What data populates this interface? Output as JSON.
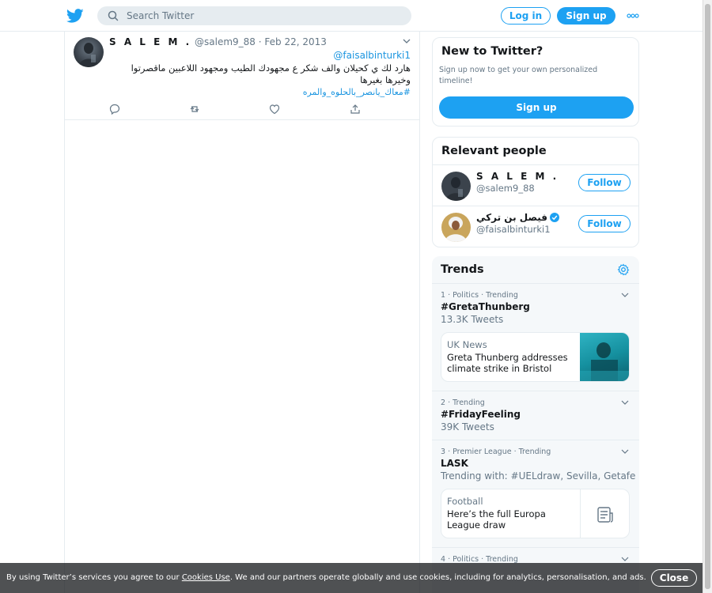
{
  "header": {
    "search_placeholder": "Search Twitter",
    "login_label": "Log in",
    "signup_label": "Sign up",
    "accent_color": "#1da1f2"
  },
  "tweet": {
    "author_name": "S A L E M .",
    "author_handle": "@salem9_88",
    "separator": "·",
    "date": "Feb 22, 2013",
    "mention": "@faisalbinturki1",
    "text": "هارد لك ي كحيلان والف شكر ع مجهودك الطيب ومجهود اللاعبين ماقصرتوا وخيرها بغيرها",
    "hashtag": "#معاك_يانصر_بالحلوه_والمره",
    "actions": [
      "reply-icon",
      "retweet-icon",
      "like-icon",
      "share-icon"
    ]
  },
  "new_to_twitter": {
    "title": "New to Twitter?",
    "subtitle": "Sign up now to get your own personalized timeline!",
    "button": "Sign up"
  },
  "relevant_people": {
    "title": "Relevant people",
    "people": [
      {
        "name": "S A L E M .",
        "handle": "@salem9_88",
        "follow_label": "Follow",
        "verified": false
      },
      {
        "name": "فيصل بن تركي",
        "handle": "@faisalbinturki1",
        "follow_label": "Follow",
        "verified": true
      }
    ]
  },
  "trends": {
    "title": "Trends",
    "items": [
      {
        "meta": "1 · Politics · Trending",
        "name": "#GretaThunberg",
        "count": "13.3K Tweets",
        "news": {
          "source": "UK News",
          "headline": "Greta Thunberg addresses climate strike in Bristol"
        }
      },
      {
        "meta": "2 · Trending",
        "name": "#FridayFeeling",
        "count": "39K Tweets"
      },
      {
        "meta": "3 · Premier League · Trending",
        "name": "LASK",
        "count": "Trending with: #UELdraw, Sevilla, Getafe",
        "news": {
          "source": "Football",
          "headline": "Here’s the full Europa League draw"
        }
      },
      {
        "meta": "4 · Politics · Trending"
      }
    ]
  },
  "cookie_banner": {
    "text_before": "By using Twitter’s services you agree to our ",
    "link": "Cookies Use",
    "text_after": ". We and our partners operate globally and use cookies, including for analytics, personalisation, and ads.",
    "close_label": "Close"
  }
}
